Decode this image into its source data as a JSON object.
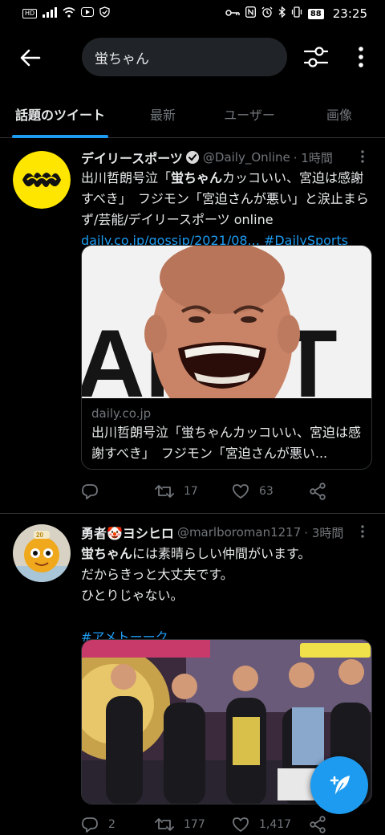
{
  "statusbar": {
    "hd": "HD",
    "battery": "88",
    "time": "23:25"
  },
  "search": {
    "query": "蛍ちゃん"
  },
  "tabs": [
    {
      "label": "話題のツイート",
      "active": true
    },
    {
      "label": "最新"
    },
    {
      "label": "ユーザー"
    },
    {
      "label": "画像"
    }
  ],
  "tweets": [
    {
      "name": "デイリースポーツ",
      "handle": "@Daily_Online",
      "time": "· 1時間",
      "text_before": "出川哲朗号泣「",
      "text_bold": "蛍ちゃん",
      "text_after": "カッコいい、宮迫は感謝すべき」　フジモン「宮迫さんが悪い」と涙止まらず/芸能/デイリースポーツ online",
      "link": "daily.co.jp/gossip/2021/08...",
      "hashtag": "#DailySports",
      "card": {
        "domain": "daily.co.jp",
        "title": "出川哲朗号泣「蛍ちゃんカッコいい、宮迫は感謝すべき」　フジモン「宮迫さんが悪い..."
      },
      "replies": "",
      "retweets": "17",
      "likes": "63"
    },
    {
      "name": "勇者🤡ヨシヒロ",
      "handle": "@marlboroman1217",
      "time": "· 3時間",
      "line1_bold": "蛍ちゃん",
      "line1_rest": "には素晴らしい仲間がいます。",
      "line2": "だからきっと大丈夫です。",
      "line3": "ひとりじゃない。",
      "hashtag": "#アメトーーク",
      "replies": "2",
      "retweets": "177",
      "likes": "1,417"
    }
  ],
  "colors": {
    "accent": "#1d9bf0",
    "background": "#000000",
    "muted": "#71767b"
  }
}
